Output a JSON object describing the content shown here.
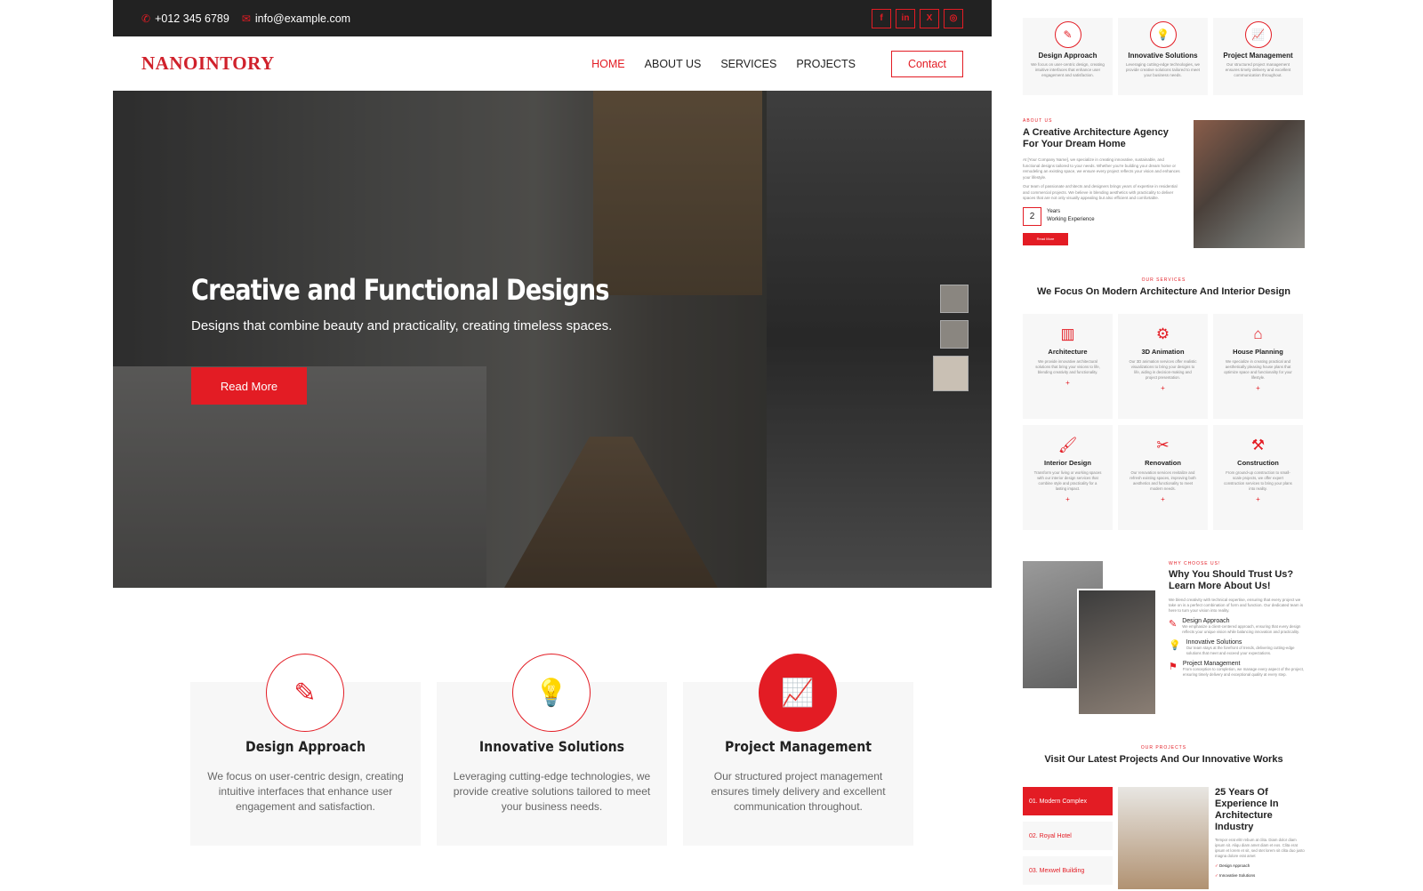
{
  "topbar": {
    "phone": "+012 345 6789",
    "email": "info@example.com",
    "social": [
      "f",
      "in",
      "X",
      "◎"
    ]
  },
  "nav": {
    "logo": "NANOINTORY",
    "items": [
      "HOME",
      "ABOUT US",
      "SERVICES",
      "PROJECTS"
    ],
    "contact": "Contact"
  },
  "hero": {
    "title": "Creative and Functional Designs",
    "subtitle": "Designs that combine beauty and practicality, creating timeless spaces.",
    "button": "Read More"
  },
  "features": [
    {
      "icon": "✎",
      "title": "Design Approach",
      "text": "We focus on user-centric design, creating intuitive interfaces that enhance user engagement and satisfaction."
    },
    {
      "icon": "💡",
      "title": "Innovative Solutions",
      "text": "Leveraging cutting-edge technologies, we provide creative solutions tailored to meet your business needs."
    },
    {
      "icon": "📈",
      "title": "Project Management",
      "text": "Our structured project management ensures timely delivery and excellent communication throughout."
    }
  ],
  "preview": {
    "mini": [
      {
        "icon": "✎",
        "title": "Design Approach",
        "text": "We focus on user-centric design, creating intuitive interfaces that enhance user engagement and satisfaction."
      },
      {
        "icon": "💡",
        "title": "Innovative Solutions",
        "text": "Leveraging cutting-edge technologies, we provide creative solutions tailored to meet your business needs."
      },
      {
        "icon": "📈",
        "title": "Project Management",
        "text": "Our structured project management ensures timely delivery and excellent communication throughout."
      }
    ],
    "about": {
      "tag": "ABOUT US",
      "title": "A Creative Architecture Agency For Your Dream Home",
      "text1": "At [Your Company Name], we specialize in creating innovative, sustainable, and functional designs tailored to your needs. Whether you're building your dream home or remodeling an existing space, we ensure every project reflects your vision and enhances your lifestyle.",
      "text2": "Our team of passionate architects and designers brings years of expertise in residential and commercial projects. We believe in blending aesthetics with practicality to deliver spaces that are not only visually appealing but also efficient and comfortable.",
      "years": "2",
      "years_label1": "Years",
      "years_label2": "Working Experience",
      "button": "Read More"
    },
    "services": {
      "tag": "OUR SERVICES",
      "title": "We Focus On Modern Architecture And Interior Design",
      "items": [
        {
          "icon": "▥",
          "title": "Architecture",
          "text": "We provide innovative architectural solutions that bring your visions to life, blending creativity and functionality."
        },
        {
          "icon": "⚙",
          "title": "3D Animation",
          "text": "Our 3D animation services offer realistic visualizations to bring your designs to life, aiding in decision-making and project presentation."
        },
        {
          "icon": "⌂",
          "title": "House Planning",
          "text": "We specialize in creating practical and aesthetically pleasing house plans that optimize space and functionality for your lifestyle."
        },
        {
          "icon": "🖌",
          "title": "Interior Design",
          "text": "Transform your living or working spaces with our interior design services that combine style and practicality for a lasting impact."
        },
        {
          "icon": "✂",
          "title": "Renovation",
          "text": "Our renovation services revitalize and refresh existing spaces, improving both aesthetics and functionality to meet modern needs."
        },
        {
          "icon": "⚒",
          "title": "Construction",
          "text": "From ground-up construction to small-scale projects, we offer expert construction services to bring your plans into reality."
        }
      ]
    },
    "trust": {
      "tag": "WHY CHOOSE US!",
      "title": "Why You Should Trust Us? Learn More About Us!",
      "text": "We blend creativity with technical expertise, ensuring that every project we take on is a perfect combination of form and function. Our dedicated team is here to turn your vision into reality.",
      "items": [
        {
          "icon": "✎",
          "title": "Design Approach",
          "text": "We emphasize a client-centered approach, ensuring that every design reflects your unique vision while balancing innovation and practicality."
        },
        {
          "icon": "💡",
          "title": "Innovative Solutions",
          "text": "Our team stays at the forefront of trends, delivering cutting-edge solutions that meet and exceed your expectations."
        },
        {
          "icon": "⚑",
          "title": "Project Management",
          "text": "From conception to completion, we manage every aspect of the project, ensuring timely delivery and exceptional quality at every step."
        }
      ]
    },
    "projects": {
      "tag": "OUR PROJECTS",
      "title": "Visit Our Latest Projects And Our Innovative Works",
      "tabs": [
        "01. Modern Complex",
        "02. Royal Hotel",
        "03. Mexwel Building"
      ],
      "heading": "25 Years Of Experience In Architecture Industry",
      "text": "Tempor erat elitr rebum at clita. Diam dolor diam ipsum sit. Aliqu diam amet diam et eos. Clita erat ipsum et lorem et sit, sed stet lorem sit clita duo justo magna dolore erat amet",
      "list": [
        "Design Approach",
        "Innovative Solutions"
      ]
    }
  }
}
